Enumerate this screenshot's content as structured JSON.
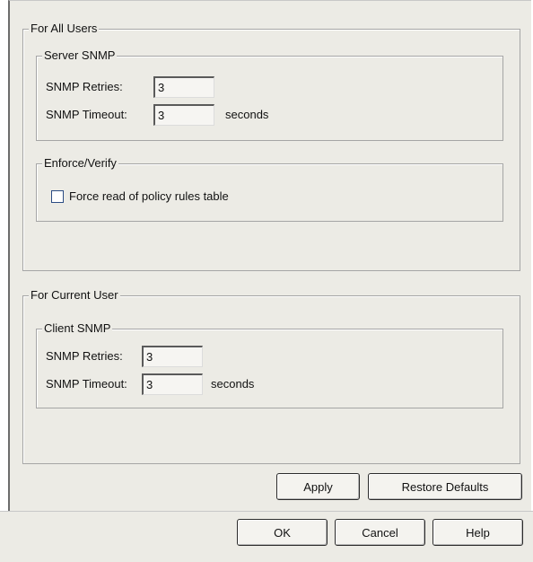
{
  "for_all_users": {
    "title": "For All Users",
    "server_snmp": {
      "title": "Server SNMP",
      "retries_label": "SNMP Retries:",
      "retries_value": "3",
      "timeout_label": "SNMP Timeout:",
      "timeout_value": "3",
      "timeout_unit": "seconds"
    },
    "enforce_verify": {
      "title": "Enforce/Verify",
      "force_read_label": "Force read of policy rules table",
      "force_read_checked": false
    }
  },
  "for_current_user": {
    "title": "For Current User",
    "client_snmp": {
      "title": "Client SNMP",
      "retries_label": "SNMP Retries:",
      "retries_value": "3",
      "timeout_label": "SNMP Timeout:",
      "timeout_value": "3",
      "timeout_unit": "seconds"
    }
  },
  "buttons": {
    "apply": "Apply",
    "restore_defaults": "Restore Defaults",
    "ok": "OK",
    "cancel": "Cancel",
    "help": "Help"
  }
}
